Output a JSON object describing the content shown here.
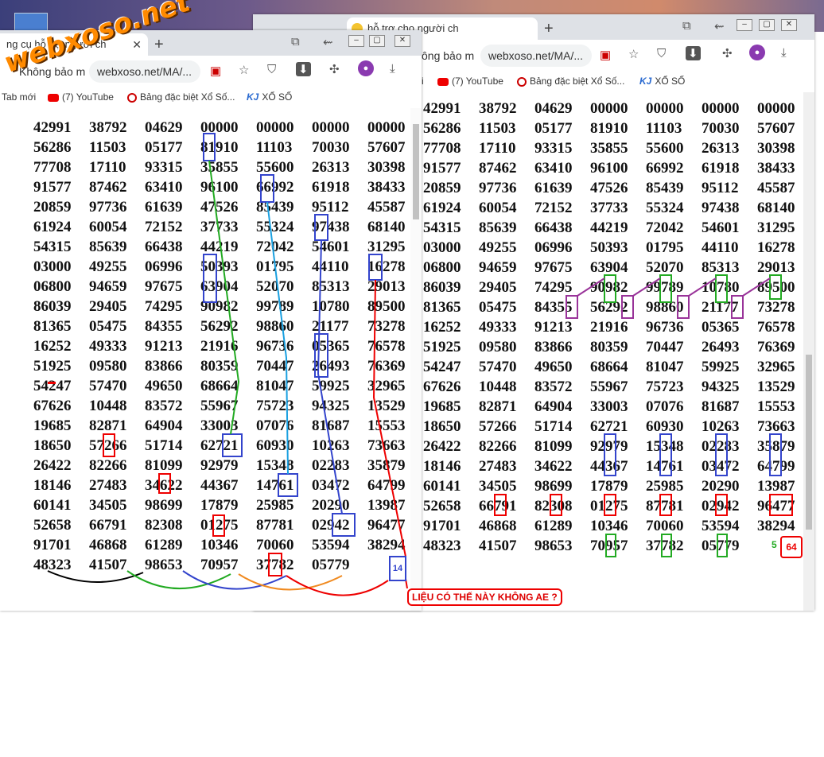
{
  "watermark": {
    "logo_text": "webxoso.net"
  },
  "back_window": {
    "tab_title": "hỗ trợ cho người ch",
    "new_tab": "+",
    "address_label": "ông bảo m",
    "url": "webxoso.net/MA/...",
    "bookmarks": [
      "(7) YouTube",
      "Bảng đặc biệt Xổ Số...",
      "XỔ SỐ"
    ],
    "bookmark_prefix": "i",
    "controls": {
      "minimize": "–",
      "maximize": "▢",
      "close": "✕"
    },
    "rows": [
      [
        "42991",
        "38792",
        "04629",
        "00000",
        "00000",
        "00000",
        "00000"
      ],
      [
        "56286",
        "11503",
        "05177",
        "81910",
        "11103",
        "70030",
        "57607"
      ],
      [
        "77708",
        "17110",
        "93315",
        "35855",
        "55600",
        "26313",
        "30398"
      ],
      [
        "91577",
        "87462",
        "63410",
        "96100",
        "66992",
        "61918",
        "38433"
      ],
      [
        "20859",
        "97736",
        "61639",
        "47526",
        "85439",
        "95112",
        "45587"
      ],
      [
        "61924",
        "60054",
        "72152",
        "37733",
        "55324",
        "97438",
        "68140"
      ],
      [
        "54315",
        "85639",
        "66438",
        "44219",
        "72042",
        "54601",
        "31295"
      ],
      [
        "03000",
        "49255",
        "06996",
        "50393",
        "01795",
        "44110",
        "16278"
      ],
      [
        "06800",
        "94659",
        "97675",
        "63904",
        "52070",
        "85313",
        "29013"
      ],
      [
        "86039",
        "29405",
        "74295",
        "90982",
        "99789",
        "10780",
        "89500"
      ],
      [
        "81365",
        "05475",
        "84355",
        "56292",
        "98860",
        "21177",
        "73278"
      ],
      [
        "16252",
        "49333",
        "91213",
        "21916",
        "96736",
        "05365",
        "76578"
      ],
      [
        "51925",
        "09580",
        "83866",
        "80359",
        "70447",
        "26493",
        "76369"
      ],
      [
        "54247",
        "57470",
        "49650",
        "68664",
        "81047",
        "59925",
        "32965"
      ],
      [
        "67626",
        "10448",
        "83572",
        "55967",
        "75723",
        "94325",
        "13529"
      ],
      [
        "19685",
        "82871",
        "64904",
        "33003",
        "07076",
        "81687",
        "15553"
      ],
      [
        "18650",
        "57266",
        "51714",
        "62721",
        "60930",
        "10263",
        "73663"
      ],
      [
        "26422",
        "82266",
        "81099",
        "92979",
        "15348",
        "02283",
        "35879"
      ],
      [
        "18146",
        "27483",
        "34622",
        "44367",
        "14761",
        "03472",
        "64799"
      ],
      [
        "60141",
        "34505",
        "98699",
        "17879",
        "25985",
        "20290",
        "13987"
      ],
      [
        "52658",
        "66791",
        "82308",
        "01275",
        "87781",
        "02942",
        "96477"
      ],
      [
        "91701",
        "46868",
        "61289",
        "10346",
        "70060",
        "53594",
        "38294"
      ],
      [
        "48323",
        "41507",
        "98653",
        "70957",
        "37782",
        "05779",
        ""
      ]
    ]
  },
  "front_window": {
    "tab_title": "ng cụ hỗ trợ người ch",
    "new_tab": "+",
    "address_label": "Không bảo m",
    "url": "webxoso.net/MA/...",
    "bookmarks": [
      "Tab mới",
      "(7) YouTube",
      "Bảng đặc biệt Xổ Số...",
      "XỔ SỐ"
    ],
    "controls": {
      "minimize": "–",
      "maximize": "▢",
      "close": "✕"
    },
    "rows": [
      [
        "42991",
        "38792",
        "04629",
        "00000",
        "00000",
        "00000",
        "00000"
      ],
      [
        "56286",
        "11503",
        "05177",
        "81910",
        "11103",
        "70030",
        "57607"
      ],
      [
        "77708",
        "17110",
        "93315",
        "35855",
        "55600",
        "26313",
        "30398"
      ],
      [
        "91577",
        "87462",
        "63410",
        "96100",
        "66992",
        "61918",
        "38433"
      ],
      [
        "20859",
        "97736",
        "61639",
        "47526",
        "85439",
        "95112",
        "45587"
      ],
      [
        "61924",
        "60054",
        "72152",
        "37733",
        "55324",
        "97438",
        "68140"
      ],
      [
        "54315",
        "85639",
        "66438",
        "44219",
        "72042",
        "54601",
        "31295"
      ],
      [
        "03000",
        "49255",
        "06996",
        "50393",
        "01795",
        "44110",
        "16278"
      ],
      [
        "06800",
        "94659",
        "97675",
        "63904",
        "52070",
        "85313",
        "29013"
      ],
      [
        "86039",
        "29405",
        "74295",
        "90982",
        "99789",
        "10780",
        "89500"
      ],
      [
        "81365",
        "05475",
        "84355",
        "56292",
        "98860",
        "21177",
        "73278"
      ],
      [
        "16252",
        "49333",
        "91213",
        "21916",
        "96736",
        "05365",
        "76578"
      ],
      [
        "51925",
        "09580",
        "83866",
        "80359",
        "70447",
        "26493",
        "76369"
      ],
      [
        "54247",
        "57470",
        "49650",
        "68664",
        "81047",
        "59925",
        "32965"
      ],
      [
        "67626",
        "10448",
        "83572",
        "55967",
        "75723",
        "94325",
        "13529"
      ],
      [
        "19685",
        "82871",
        "64904",
        "33003",
        "07076",
        "81687",
        "15553"
      ],
      [
        "18650",
        "57266",
        "51714",
        "62721",
        "60930",
        "10263",
        "73663"
      ],
      [
        "26422",
        "82266",
        "81099",
        "92979",
        "15348",
        "02283",
        "35879"
      ],
      [
        "18146",
        "27483",
        "34622",
        "44367",
        "14761",
        "03472",
        "64799"
      ],
      [
        "60141",
        "34505",
        "98699",
        "17879",
        "25985",
        "20290",
        "13987"
      ],
      [
        "52658",
        "66791",
        "82308",
        "01275",
        "87781",
        "02942",
        "96477"
      ],
      [
        "91701",
        "46868",
        "61289",
        "10346",
        "70060",
        "53594",
        "38294"
      ],
      [
        "48323",
        "41507",
        "98653",
        "70957",
        "37782",
        "05779",
        ""
      ]
    ]
  },
  "annotations": {
    "note": "LIỆU CÓ THẾ NÀY KHÔNG AE ?",
    "badge_blue": "14",
    "badge_red": "64",
    "label_green": "5",
    "colors": {
      "red": "#e00000",
      "blue": "#3344cc",
      "green": "#22aa22",
      "purple": "#993399",
      "cyan": "#1aa0e0",
      "orange": "#f08a20",
      "black": "#000000"
    }
  }
}
